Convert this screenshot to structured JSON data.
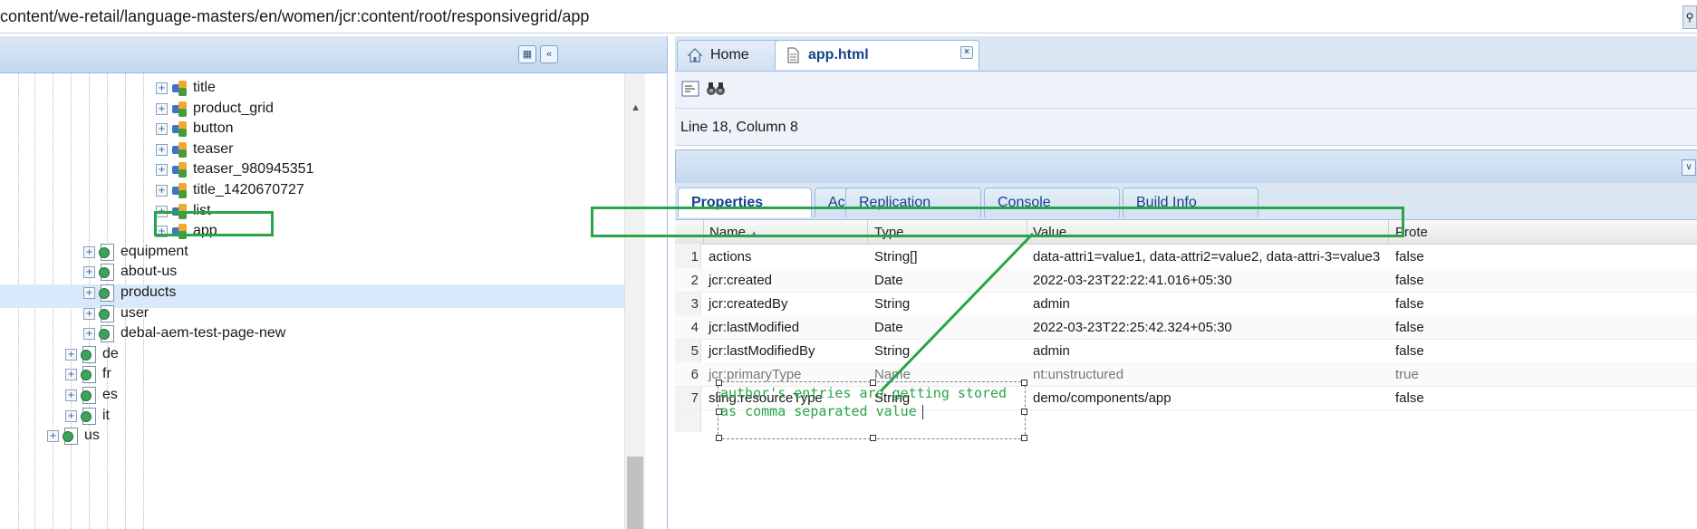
{
  "address_bar": {
    "path": "content/we-retail/language-masters/en/women/jcr:content/root/responsivegrid/app"
  },
  "tree": {
    "nodes": [
      {
        "label": "title",
        "icon": "component-icon"
      },
      {
        "label": "product_grid",
        "icon": "component-icon"
      },
      {
        "label": "button",
        "icon": "component-icon"
      },
      {
        "label": "teaser",
        "icon": "component-icon"
      },
      {
        "label": "teaser_980945351",
        "icon": "component-icon"
      },
      {
        "label": "title_1420670727",
        "icon": "component-icon"
      },
      {
        "label": "list",
        "icon": "component-icon"
      },
      {
        "label": "app",
        "icon": "component-icon",
        "selected": true
      },
      {
        "label": "equipment",
        "icon": "page-icon"
      },
      {
        "label": "about-us",
        "icon": "page-icon"
      },
      {
        "label": "products",
        "icon": "page-icon"
      },
      {
        "label": "user",
        "icon": "page-icon"
      },
      {
        "label": "debal-aem-test-page-new",
        "icon": "page-icon"
      },
      {
        "label": "de",
        "icon": "page-icon"
      },
      {
        "label": "fr",
        "icon": "page-icon"
      },
      {
        "label": "es",
        "icon": "page-icon"
      },
      {
        "label": "it",
        "icon": "page-icon"
      },
      {
        "label": "us",
        "icon": "page-icon"
      }
    ]
  },
  "editor_tabs": {
    "home": "Home",
    "app_html": "app.html"
  },
  "status": {
    "cursor": "Line 18, Column 8"
  },
  "property_tabs": [
    "Properties",
    "Access Control",
    "Replication",
    "Console",
    "Build Info"
  ],
  "grid": {
    "columns": {
      "name": "Name",
      "type": "Type",
      "value": "Value",
      "protected": "Prote"
    },
    "rows": [
      {
        "n": "1",
        "name": "actions",
        "type": "String[]",
        "value": "data-attri1=value1, data-attri2=value2, data-attri-3=value3",
        "protected": "false"
      },
      {
        "n": "2",
        "name": "jcr:created",
        "type": "Date",
        "value": "2022-03-23T22:22:41.016+05:30",
        "protected": "false"
      },
      {
        "n": "3",
        "name": "jcr:createdBy",
        "type": "String",
        "value": "admin",
        "protected": "false"
      },
      {
        "n": "4",
        "name": "jcr:lastModified",
        "type": "Date",
        "value": "2022-03-23T22:25:42.324+05:30",
        "protected": "false"
      },
      {
        "n": "5",
        "name": "jcr:lastModifiedBy",
        "type": "String",
        "value": "admin",
        "protected": "false"
      },
      {
        "n": "6",
        "name": "jcr:primaryType",
        "type": "Name",
        "value": "nt:unstructured",
        "protected": "true"
      },
      {
        "n": "7",
        "name": "sling:resourceType",
        "type": "String",
        "value": "demo/components/app",
        "protected": "false"
      }
    ]
  },
  "annotation": {
    "line1": "author's entries are getting stored",
    "line2": "as comma separated value",
    "color": "#2aa44a"
  }
}
